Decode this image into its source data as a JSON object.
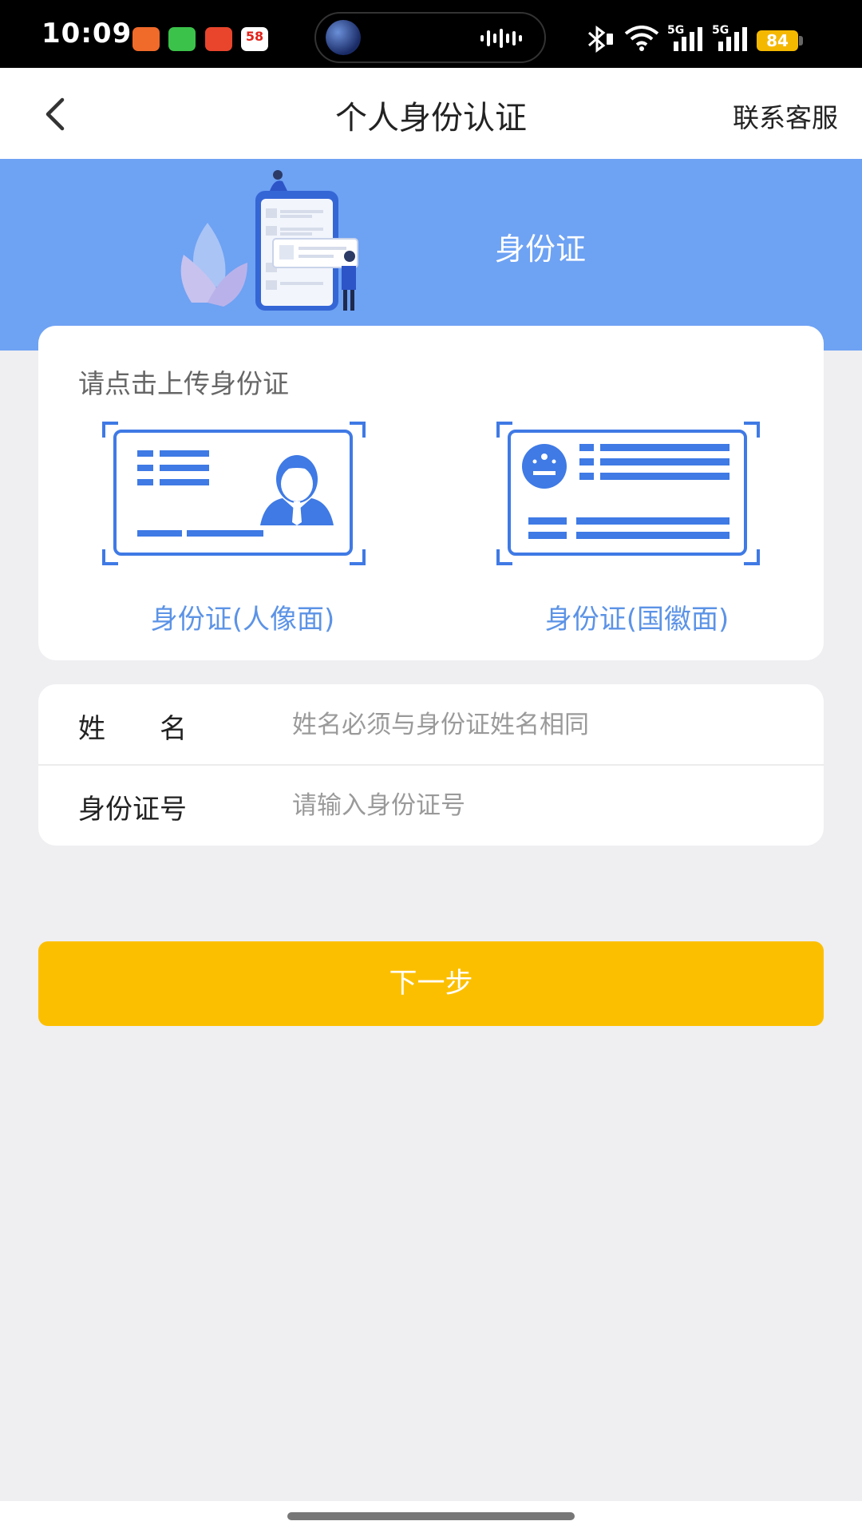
{
  "status_bar": {
    "time": "10:09",
    "battery": "84",
    "network_label_1": "5G",
    "network_label_2": "5G",
    "app_icon_4_text": "58"
  },
  "navbar": {
    "title": "个人身份认证",
    "right_action": "联系客服"
  },
  "banner": {
    "title": "身份证"
  },
  "upload": {
    "hint": "请点击上传身份证",
    "front_label": "身份证(人像面)",
    "back_label": "身份证(国徽面)"
  },
  "form": {
    "name_label": "姓　　名",
    "name_placeholder": "姓名必须与身份证姓名相同",
    "id_label": "身份证号",
    "id_placeholder": "请输入身份证号"
  },
  "actions": {
    "next": "下一步"
  },
  "colors": {
    "banner": "#6ea2f3",
    "accent_blue": "#3f7ae5",
    "button": "#fcbf00",
    "background": "#efeef1"
  }
}
